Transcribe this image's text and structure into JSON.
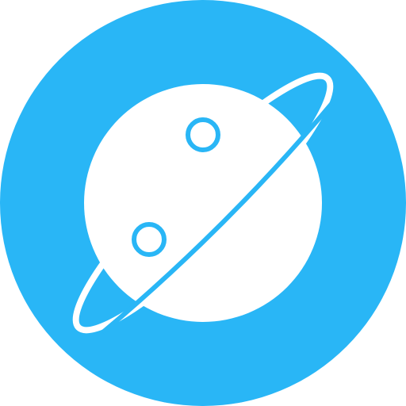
{
  "icon": {
    "name": "planet-icon",
    "background_color": "#29B6F6",
    "foreground_color": "#FFFFFF"
  }
}
